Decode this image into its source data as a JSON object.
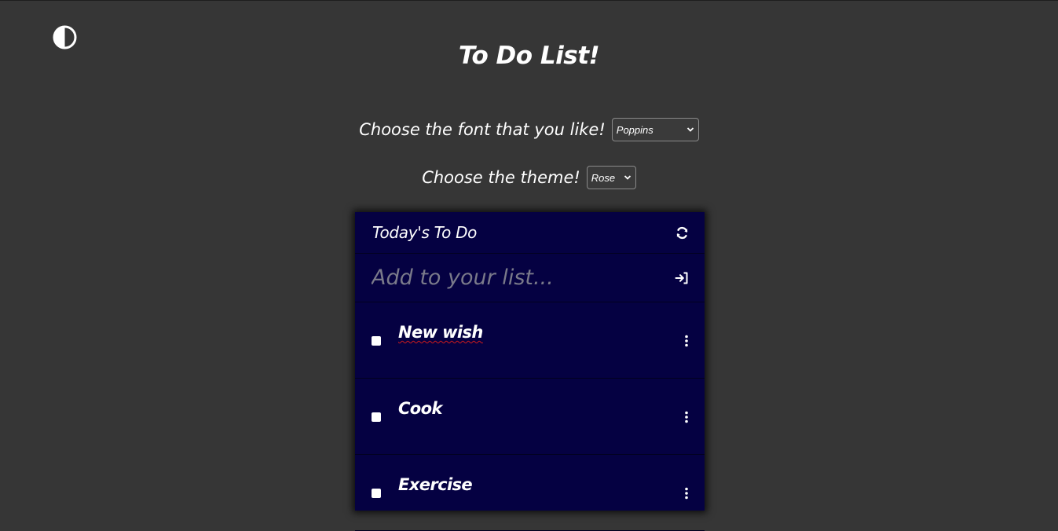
{
  "page": {
    "title": "To Do List!"
  },
  "settings": {
    "font_label": "Choose the font that you like!",
    "font_value": "Poppins",
    "theme_label": "Choose the theme!",
    "theme_value": "Rose"
  },
  "card": {
    "title": "Today's To Do",
    "input_placeholder": "Add to your list...",
    "items": [
      {
        "label": "New wish",
        "checked": false
      },
      {
        "label": "Cook",
        "checked": false
      },
      {
        "label": "Exercise",
        "checked": false
      }
    ]
  },
  "colors": {
    "background": "#363636",
    "card": "#050142",
    "text": "#ffffff"
  },
  "icons": {
    "theme_toggle": "half-circle-contrast-icon",
    "refresh": "refresh-icon",
    "submit": "sign-in-arrow-icon",
    "item_menu": "vertical-ellipsis-icon"
  }
}
